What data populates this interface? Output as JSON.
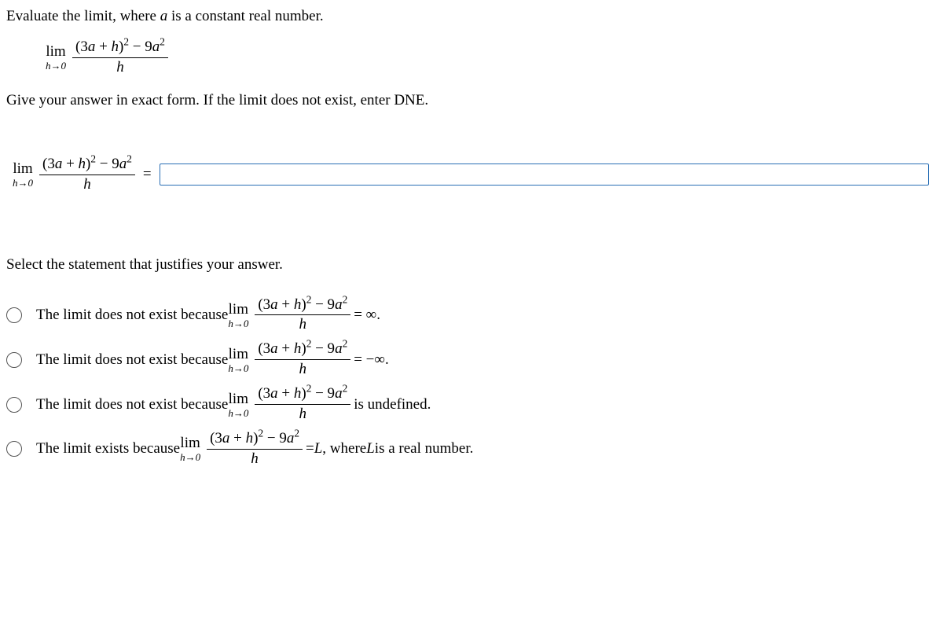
{
  "question": {
    "prefix": "Evaluate the limit, where ",
    "var": "a",
    "suffix": " is a constant real number."
  },
  "limit_expr": {
    "lim": "lim",
    "approach": "h→0",
    "numerator": "(3a + h)² − 9a²",
    "numerator_plain_open": "(3",
    "numerator_var1": "a",
    "numerator_plus": " + ",
    "numerator_var2": "h",
    "numerator_close": ")",
    "numerator_minus": " − 9",
    "numerator_var3": "a",
    "denominator": "h"
  },
  "instruction": "Give your answer in exact form. If the limit does not exist, enter DNE.",
  "equals": "=",
  "answer_input": {
    "value": ""
  },
  "select_prompt": "Select the statement that justifies your answer.",
  "options": {
    "dne_prefix": "The limit does not exist because ",
    "exists_prefix": "The limit exists because ",
    "inf": " = ∞.",
    "neg_inf": " = −∞.",
    "undefined": " is undefined.",
    "real_eq": " = ",
    "real_L": "L",
    "real_comma": ", where ",
    "real_L2": "L",
    "real_tail": " is a real number."
  }
}
